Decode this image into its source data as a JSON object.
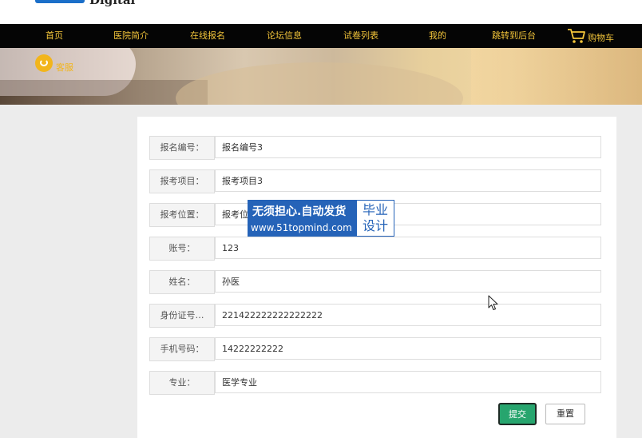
{
  "header": {
    "logo_text": "Digital"
  },
  "nav": {
    "items": [
      "首页",
      "医院简介",
      "在线报名",
      "论坛信息",
      "试卷列表",
      "我的",
      "跳转到后台",
      "购物车"
    ],
    "color": "#f3c53a",
    "background": "#050505"
  },
  "banner": {
    "service_label": "客服",
    "service_icon": "chat-bubble-icon"
  },
  "form": {
    "fields": [
      {
        "label": "报名编号：",
        "value": "报名编号3"
      },
      {
        "label": "报考项目：",
        "value": "报考项目3"
      },
      {
        "label": "报考位置：",
        "value": "报考位"
      },
      {
        "label": "账号：",
        "value": "123"
      },
      {
        "label": "姓名：",
        "value": "孙医"
      },
      {
        "label": "身份证号…",
        "value": "221422222222222222"
      },
      {
        "label": "手机号码：",
        "value": "14222222222"
      },
      {
        "label": "专业：",
        "value": "医学专业"
      }
    ],
    "submit_label": "提交",
    "reset_label": "重置",
    "submit_color": "#27a56e"
  },
  "watermark": {
    "line1": "无须担心.自动发货",
    "line2": "www.51topmind.com",
    "tag1": "毕业",
    "tag2": "设计",
    "color": "#2563b8"
  }
}
